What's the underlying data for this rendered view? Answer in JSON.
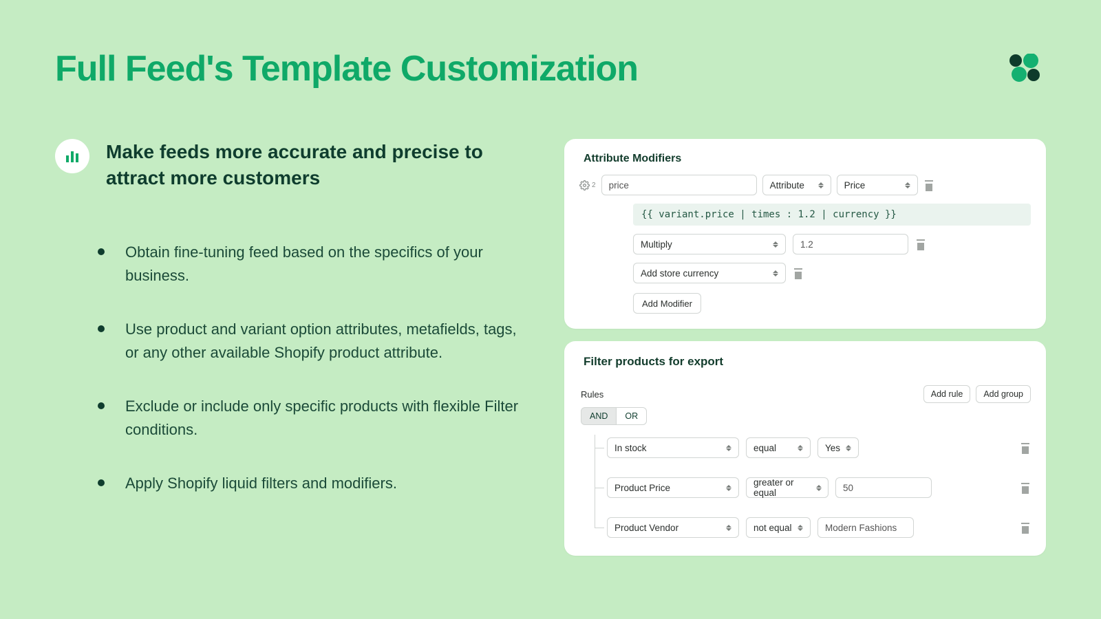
{
  "title": "Full Feed's Template Customization",
  "lead": "Make feeds more accurate and precise to attract more customers",
  "bullets": [
    "Obtain fine-tuning feed based on the specifics of your business.",
    "Use product and variant option attributes, metafields, tags, or any other available Shopify product attribute.",
    "Exclude or include only specific products with flexible Filter conditions.",
    "Apply Shopify liquid filters and modifiers."
  ],
  "modifiers": {
    "heading": "Attribute Modifiers",
    "gear_badge": "2",
    "field_name": "price",
    "type_select": "Attribute",
    "attr_select": "Price",
    "code": "{{ variant.price | times : 1.2 | currency }}",
    "op_select": "Multiply",
    "op_value": "1.2",
    "op2_select": "Add store currency",
    "add_label": "Add Modifier"
  },
  "filters": {
    "heading": "Filter products for export",
    "rules_label": "Rules",
    "and_label": "AND",
    "or_label": "OR",
    "add_rule": "Add rule",
    "add_group": "Add group",
    "rows": [
      {
        "field": "In stock",
        "op": "equal",
        "value": "Yes",
        "value_is_select": true
      },
      {
        "field": "Product Price",
        "op": "greater or equal",
        "value": "50",
        "value_is_select": false
      },
      {
        "field": "Product Vendor",
        "op": "not equal",
        "value": "Modern Fashions",
        "value_is_select": false
      }
    ]
  }
}
